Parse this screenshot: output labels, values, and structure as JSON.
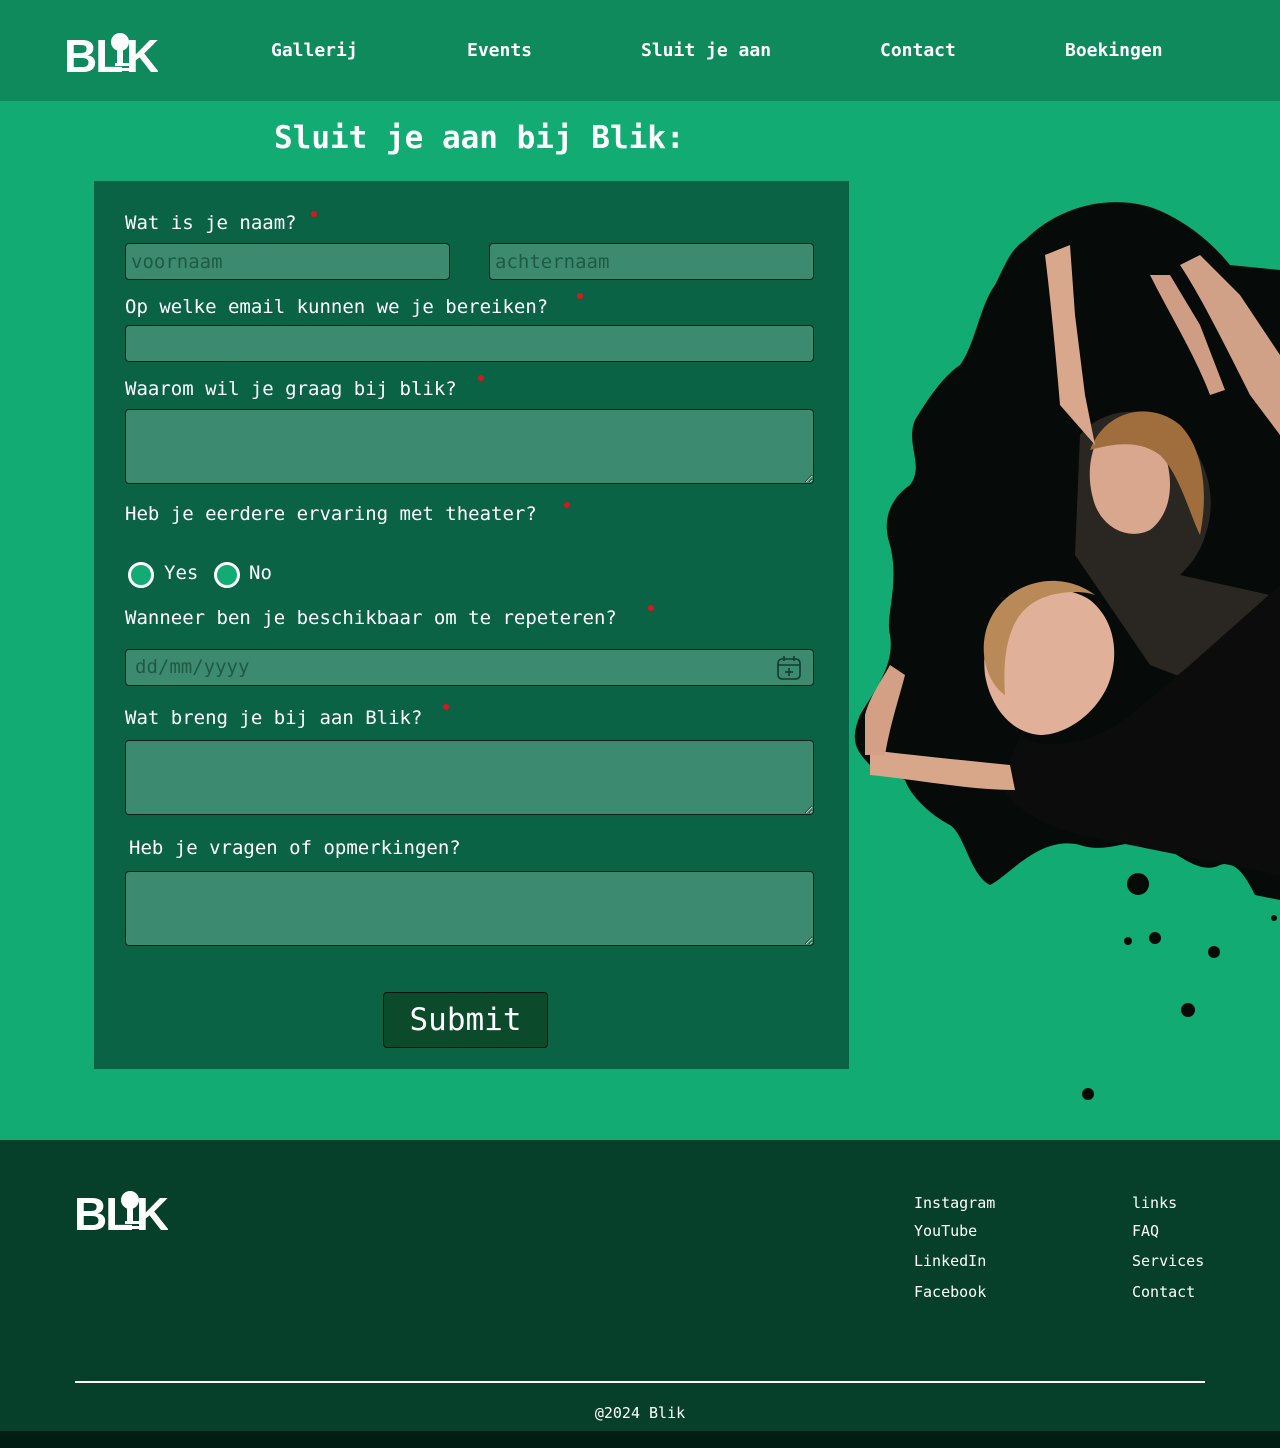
{
  "brand": {
    "logo_text": "BLIK"
  },
  "nav": {
    "items": [
      {
        "label": "Gallerij"
      },
      {
        "label": "Events"
      },
      {
        "label": "Sluit je aan"
      },
      {
        "label": "Contact"
      },
      {
        "label": "Boekingen"
      }
    ]
  },
  "page": {
    "title": "Sluit je aan bij Blik:"
  },
  "form": {
    "name_label": "Wat is je naam?",
    "first_name_placeholder": "voornaam",
    "last_name_placeholder": "achternaam",
    "email_label": "Op welke email kunnen we je bereiken?",
    "email_value": "",
    "why_label": "Waarom wil je graag bij blik?",
    "experience_label": "Heb je eerdere ervaring met theater?",
    "option_yes": "Yes",
    "option_no": "No",
    "availability_label": "Wanneer ben je beschikbaar om te repeteren?",
    "date_placeholder": "dd/mm/yyyy",
    "bring_label": "Wat breng je bij aan Blik?",
    "questions_label": "Heb je vragen of opmerkingen?",
    "submit_label": "Submit",
    "required_color": "#e0141e"
  },
  "footer": {
    "social": [
      "Instagram",
      "YouTube",
      "LinkedIn",
      "Facebook"
    ],
    "links": [
      "links",
      "FAQ",
      "Services",
      "Contact"
    ],
    "copyright": "@2024 Blik"
  },
  "colors": {
    "page_bg": "#12ab73",
    "header_bg": "#0e8a5c",
    "form_bg": "#0a6344",
    "field_bg": "#3c8a6f",
    "footer_bg": "#06402b"
  },
  "icons": {
    "logo": "blik-lightbulb-logo",
    "calendar": "calendar-plus-icon",
    "resize": "resize-handle-icon"
  }
}
